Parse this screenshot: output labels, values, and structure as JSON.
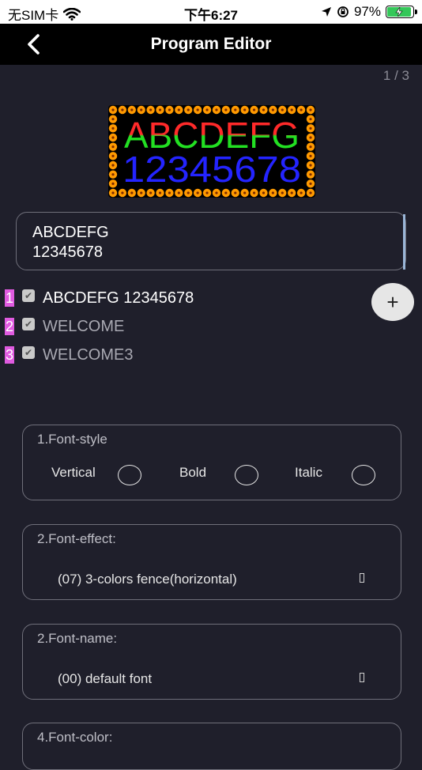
{
  "status_bar": {
    "carrier": "无SIM卡",
    "time": "下午6:27",
    "battery": "97%",
    "battery_level": 0.97
  },
  "nav": {
    "title": "Program Editor",
    "back_icon": "chevron-left-icon"
  },
  "page_indicator": "1 / 3",
  "preview": {
    "line1": "ABCDEFG",
    "line2": "12345678"
  },
  "text_input": {
    "line1": "ABCDEFG",
    "line2": "12345678"
  },
  "programs": [
    {
      "number": "1",
      "label": "ABCDEFG 12345678",
      "checked": true,
      "active": true
    },
    {
      "number": "2",
      "label": "WELCOME",
      "checked": true,
      "active": false
    },
    {
      "number": "3",
      "label": "WELCOME3",
      "checked": true,
      "active": false
    }
  ],
  "add_button": {
    "label": "+"
  },
  "font_style": {
    "title": "1.Font-style",
    "options": [
      "Vertical",
      "Bold",
      "Italic"
    ]
  },
  "font_effect": {
    "title": "2.Font-effect:",
    "value": "(07) 3-colors fence(horizontal)"
  },
  "font_name": {
    "title": "2.Font-name:",
    "value": "(00) default font"
  },
  "font_color": {
    "title": "4.Font-color:"
  },
  "colors": {
    "background": "#1f1f2b",
    "navbar": "#000000",
    "number_badge": "#e05be0",
    "preview_line1_top": "#ff2a2a",
    "preview_line1_bottom": "#22e022",
    "preview_line2": "#2424ff",
    "fence": "#ff9a00"
  }
}
